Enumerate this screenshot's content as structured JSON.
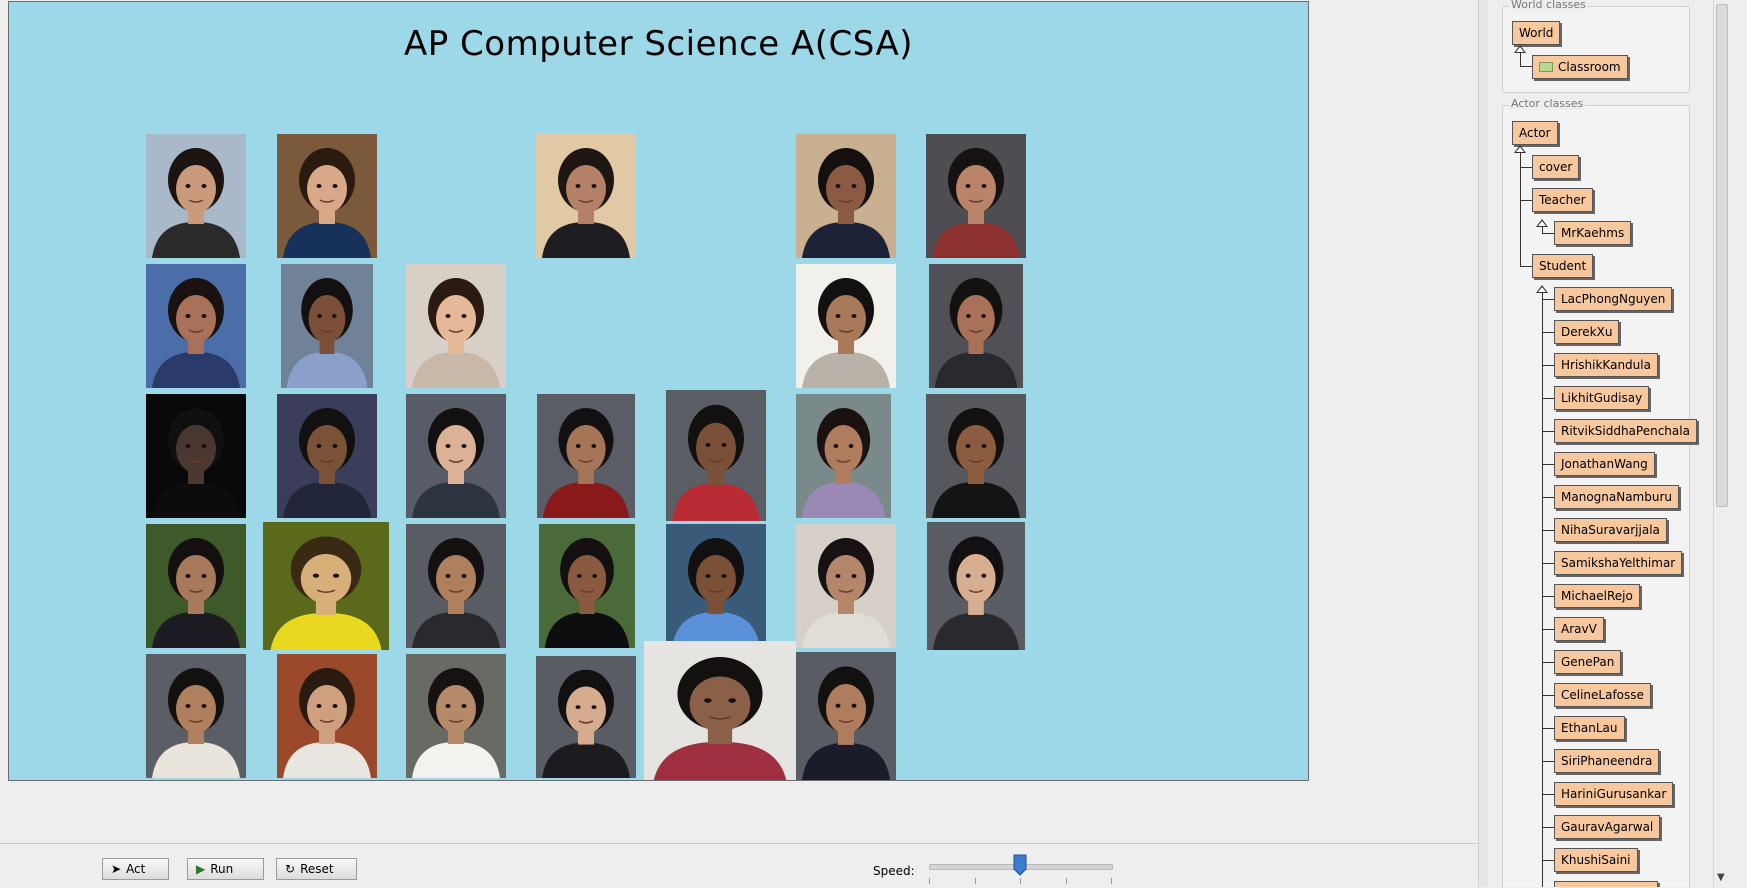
{
  "world": {
    "title": "AP Computer Science A(CSA)",
    "background": "#9dd8e8",
    "photos": [
      {
        "name": "student-photo",
        "bg": "#a9b9c9",
        "skin": "#c99a7c",
        "hair": "#1b1410",
        "shirt": "#2a2a2a"
      },
      {
        "name": "student-photo",
        "bg": "#7a5a3a",
        "skin": "#d8a888",
        "hair": "#2a1a10",
        "shirt": "#16325a"
      },
      {
        "name": "student-photo",
        "bg": "#e0c9a4",
        "skin": "#b48068",
        "hair": "#1e1612",
        "shirt": "#1e1e22"
      },
      {
        "name": "student-photo",
        "bg": "#c8b090",
        "skin": "#8a5b42",
        "hair": "#141010",
        "shirt": "#1c2238"
      },
      {
        "name": "student-photo",
        "bg": "#4e4e52",
        "skin": "#b98468",
        "hair": "#161212",
        "shirt": "#8c3030"
      },
      {
        "name": "student-photo",
        "bg": "#4b6ea8",
        "skin": "#a9715a",
        "hair": "#1a1210",
        "shirt": "#2a3a6a"
      },
      {
        "name": "student-photo",
        "bg": "#6f8298",
        "skin": "#7c5038",
        "hair": "#151010",
        "shirt": "#8aa0c8"
      },
      {
        "name": "student-photo",
        "bg": "#d8cfc6",
        "skin": "#e4b899",
        "hair": "#2a1a12",
        "shirt": "#c9b8a8"
      },
      {
        "name": "student-photo",
        "bg": "#f2f0ea",
        "skin": "#a97a5a",
        "hair": "#121010",
        "shirt": "#b8b2a8"
      },
      {
        "name": "student-photo",
        "bg": "#505056",
        "skin": "#a87158",
        "hair": "#131010",
        "shirt": "#2a2a2e"
      },
      {
        "name": "student-photo",
        "bg": "#080808",
        "skin": "#4a3830",
        "hair": "#101010",
        "shirt": "#0c0c0c"
      },
      {
        "name": "student-photo",
        "bg": "#3a3e5a",
        "skin": "#7a5238",
        "hair": "#121010",
        "shirt": "#22263a"
      },
      {
        "name": "student-photo",
        "bg": "#585c66",
        "skin": "#dcb296",
        "hair": "#121010",
        "shirt": "#2c3440"
      },
      {
        "name": "student-photo",
        "bg": "#5a5d66",
        "skin": "#a57558",
        "hair": "#121010",
        "shirt": "#8a1a1a"
      },
      {
        "name": "student-photo",
        "bg": "#5c5e66",
        "skin": "#7a5038",
        "hair": "#131010",
        "shirt": "#b82a34"
      },
      {
        "name": "student-photo",
        "bg": "#7a8a8a",
        "skin": "#b07c5e",
        "hair": "#1a1210",
        "shirt": "#9a88b6"
      },
      {
        "name": "student-photo",
        "bg": "#56585e",
        "skin": "#8c5c40",
        "hair": "#131010",
        "shirt": "#141414"
      },
      {
        "name": "student-photo",
        "bg": "#3e5a2a",
        "skin": "#a87a5c",
        "hair": "#141010",
        "shirt": "#1c1c22"
      },
      {
        "name": "student-photo",
        "bg": "#5a6a1a",
        "skin": "#d6b078",
        "hair": "#3a2a14",
        "shirt": "#e8d820"
      },
      {
        "name": "student-photo",
        "bg": "#5a5c64",
        "skin": "#b0805e",
        "hair": "#141010",
        "shirt": "#2a2a2e"
      },
      {
        "name": "student-photo",
        "bg": "#4a6a3a",
        "skin": "#8a5a40",
        "hair": "#141010",
        "shirt": "#0e0e10"
      },
      {
        "name": "student-photo",
        "bg": "#3a5a7a",
        "skin": "#7a5036",
        "hair": "#121010",
        "shirt": "#5a90d8"
      },
      {
        "name": "student-photo",
        "bg": "#d6d0c8",
        "skin": "#b4866a",
        "hair": "#161212",
        "shirt": "#e0dcd6"
      },
      {
        "name": "student-photo",
        "bg": "#5a5c64",
        "skin": "#d8ae90",
        "hair": "#121010",
        "shirt": "#2a2a2e"
      },
      {
        "name": "student-photo",
        "bg": "#5c5e66",
        "skin": "#b0805e",
        "hair": "#131010",
        "shirt": "#e8e4dc"
      },
      {
        "name": "student-photo",
        "bg": "#9a4a2a",
        "skin": "#cfa080",
        "hair": "#2a1a10",
        "shirt": "#e8e6de"
      },
      {
        "name": "student-photo",
        "bg": "#6a6a64",
        "skin": "#b48a6a",
        "hair": "#161212",
        "shirt": "#f2f2ee"
      },
      {
        "name": "student-photo",
        "bg": "#5a5c64",
        "skin": "#d6ac8e",
        "hair": "#121010",
        "shirt": "#1c1c20"
      },
      {
        "name": "student-photo",
        "bg": "#e6e4e0",
        "skin": "#8a6048",
        "hair": "#141010",
        "shirt": "#a03040"
      },
      {
        "name": "student-photo",
        "bg": "#5a5c64",
        "skin": "#b07c5e",
        "hair": "#131010",
        "shirt": "#1a1c2a"
      }
    ]
  },
  "controls": {
    "act_label": "Act",
    "run_label": "Run",
    "reset_label": "Reset",
    "speed_label": "Speed:",
    "speed_level": 0.5
  },
  "class_panel": {
    "world_group_label": "World classes",
    "world_root": "World",
    "world_child": "Classroom",
    "actor_group_label": "Actor classes",
    "actor_root": "Actor",
    "actor_children": [
      "cover",
      "Teacher"
    ],
    "teacher_child": "MrKaehms",
    "student_root": "Student",
    "students": [
      "LacPhongNguyen",
      "DerekXu",
      "HrishikKandula",
      "LikhitGudisay",
      "RitvikSiddhaPenchala",
      "JonathanWang",
      "ManognaNamburu",
      "NihaSuravarjjala",
      "SamikshaYelthimar",
      "MichaelRejo",
      "AravV",
      "GenePan",
      "CelineLafosse",
      "EthanLau",
      "SiriPhaneendra",
      "HariniGurusankar",
      "GauravAgarwal",
      "KhushiSaini"
    ]
  }
}
